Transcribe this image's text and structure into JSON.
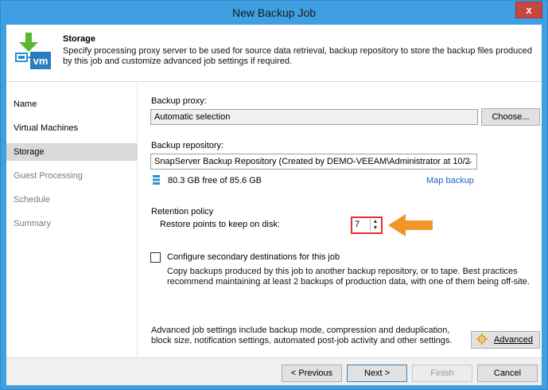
{
  "window": {
    "title": "New Backup Job",
    "close_label": "x"
  },
  "header": {
    "title": "Storage",
    "description": "Specify processing proxy server to be used for source data retrieval, backup repository to store the backup files produced by this job and customize advanced job settings if required.",
    "logo_text": "vm"
  },
  "sidebar": {
    "items": [
      {
        "label": "Name",
        "state": "done"
      },
      {
        "label": "Virtual Machines",
        "state": "done"
      },
      {
        "label": "Storage",
        "state": "active"
      },
      {
        "label": "Guest Processing",
        "state": "pending"
      },
      {
        "label": "Schedule",
        "state": "pending"
      },
      {
        "label": "Summary",
        "state": "pending"
      }
    ]
  },
  "main": {
    "proxy_label": "Backup proxy:",
    "proxy_value": "Automatic selection",
    "choose_label": "Choose...",
    "repo_label": "Backup repository:",
    "repo_value": "SnapServer Backup Repository (Created by DEMO-VEEAM\\Administrator at 10/2",
    "repo_free": "80.3 GB free of 85.6 GB",
    "map_backup": "Map backup",
    "retention_title": "Retention policy",
    "restore_points_label": "Restore points to keep on disk:",
    "restore_points_value": "7",
    "secondary_label": "Configure secondary destinations for this job",
    "secondary_desc": "Copy backups produced by this job to another backup repository, or to tape. Best practices recommend maintaining at least 2 backups of production data, with one of them being off-site.",
    "advanced_desc": "Advanced job settings include backup mode, compression and deduplication, block size, notification settings, automated post-job activity and other settings.",
    "advanced_label": "Advanced"
  },
  "footer": {
    "previous_label": "< Previous",
    "next_label": "Next >",
    "finish_label": "Finish",
    "cancel_label": "Cancel"
  },
  "colors": {
    "titlebar": "#3f9fe0",
    "close": "#c9453f",
    "highlight_box": "#e03030",
    "arrow": "#f0962a",
    "link": "#1a64c8"
  }
}
